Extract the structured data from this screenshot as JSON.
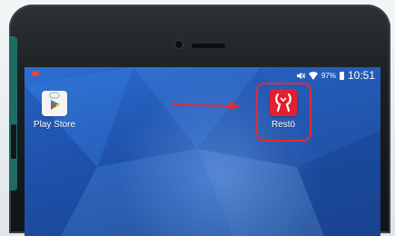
{
  "status_bar": {
    "battery": "97%",
    "time": "10:51"
  },
  "home_screen": {
    "apps": [
      {
        "label": "Play Store",
        "icon": "play-store-icon"
      },
      {
        "label": "Restö",
        "icon": "resto-icon"
      }
    ]
  },
  "annotation": {
    "arrow_color": "#e32a30",
    "highlight_color": "#e32a30"
  },
  "colors": {
    "resto_brand": "#e3202e",
    "phone_body": "#1b1f22",
    "wallpaper": "#2157b3"
  }
}
